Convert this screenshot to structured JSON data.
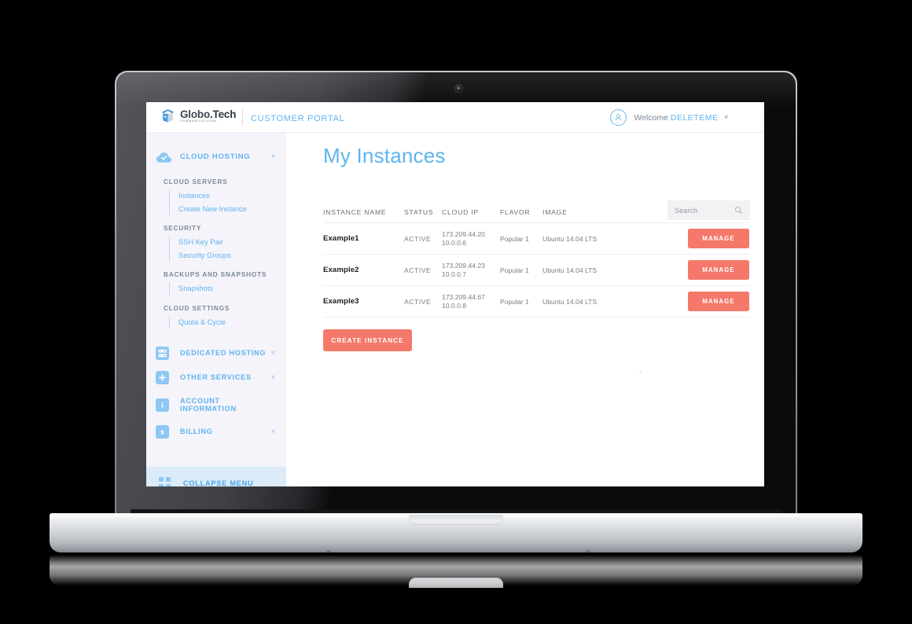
{
  "brand": {
    "name_part1": "Globo",
    "name_part2": ".Tech",
    "tagline": "COMMUNICATIONS",
    "logo_icon": "cube-logo-icon"
  },
  "header": {
    "portal_title": "CUSTOMER PORTAL",
    "welcome_prefix": "Welcome ",
    "username": "DELETEME",
    "caret_icon": "chevron-down-icon",
    "avatar_icon": "user-avatar-icon"
  },
  "sidebar": {
    "primary": {
      "label": "CLOUD HOSTING",
      "icon": "cloud-check-icon",
      "caret_icon": "chevron-down-icon"
    },
    "groups": [
      {
        "title": "CLOUD SERVERS",
        "items": [
          {
            "label": "Instances"
          },
          {
            "label": "Create New Instance"
          }
        ]
      },
      {
        "title": "SECURITY",
        "items": [
          {
            "label": "SSH Key Pair"
          },
          {
            "label": "Security Groups"
          }
        ]
      },
      {
        "title": "BACKUPS AND SNAPSHOTS",
        "items": [
          {
            "label": "Snapshots"
          }
        ]
      },
      {
        "title": "CLOUD SETTINGS",
        "items": [
          {
            "label": "Quota & Cycle"
          }
        ]
      }
    ],
    "sections": [
      {
        "label": "DEDICATED HOSTING",
        "icon": "server-rack-icon",
        "caret": true
      },
      {
        "label": "OTHER SERVICES",
        "icon": "plus-square-icon",
        "caret": true
      },
      {
        "label": "ACCOUNT INFORMATION",
        "icon": "info-square-icon",
        "caret": false
      },
      {
        "label": "BILLING",
        "icon": "dollar-square-icon",
        "caret": true
      }
    ],
    "collapse": {
      "label": "COLLAPSE MENU",
      "icon": "grid-squares-icon"
    }
  },
  "main": {
    "page_title": "My Instances",
    "search": {
      "placeholder": "Search",
      "value": "",
      "icon": "search-icon"
    },
    "table": {
      "columns": [
        "INSTANCE NAME",
        "STATUS",
        "CLOUD IP",
        "FLAVOR",
        "IMAGE"
      ],
      "rows": [
        {
          "name": "Example1",
          "status": "ACTIVE",
          "ip_public": "173.209.44.20",
          "ip_private": "10.0.0.6",
          "flavor": "Popular 1",
          "image": "Ubuntu 14.04 LTS",
          "action": "MANAGE"
        },
        {
          "name": "Example2",
          "status": "ACTIVE",
          "ip_public": "173.209.44.23",
          "ip_private": "10.0.0.7",
          "flavor": "Popular 1",
          "image": "Ubuntu 14.04 LTS",
          "action": "MANAGE"
        },
        {
          "name": "Example3",
          "status": "ACTIVE",
          "ip_public": "173.209.44.67",
          "ip_private": "10.0.0.8",
          "flavor": "Popular 1",
          "image": "Ubuntu 14.04 LTS",
          "action": "MANAGE"
        }
      ]
    },
    "create_button": "CREATE INSTANCE"
  },
  "colors": {
    "accent_blue": "#5fb4ef",
    "accent_coral": "#f4796b",
    "sidebar_bg": "#f4f4fa",
    "collapse_bg": "#dbebf8",
    "icon_blue": "#8ec7f3",
    "text_dark": "#1c1c1c",
    "text_muted": "#7d7d85"
  }
}
